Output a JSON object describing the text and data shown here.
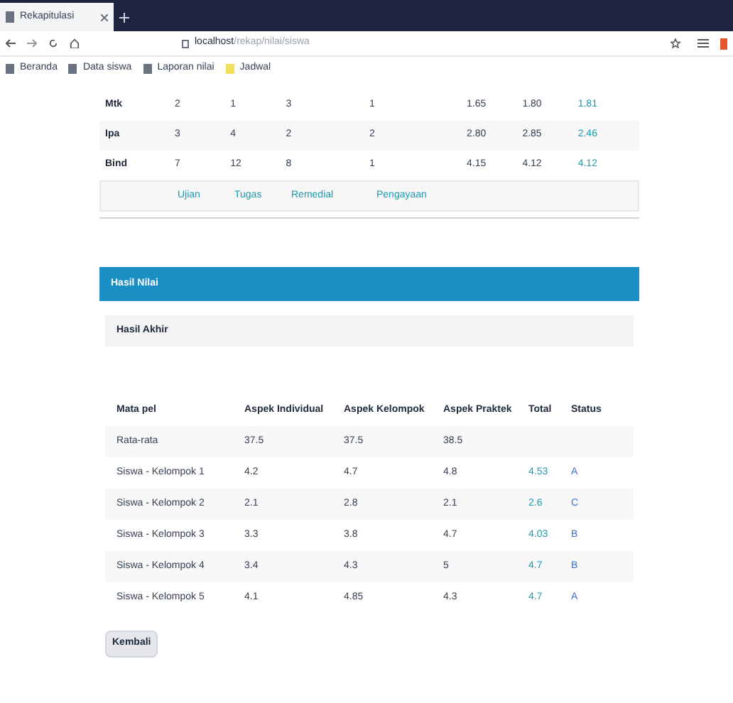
{
  "browser": {
    "tab_title": "Rekapitulasi",
    "url_host": "localhost",
    "url_path": "/rekap/nilai/siswa",
    "bookmarks": [
      "Beranda",
      "Data siswa",
      "Laporan nilai",
      "Jadwal"
    ]
  },
  "summary_table": {
    "rows": [
      {
        "label": "Mtk",
        "cells": [
          "2",
          "1",
          "3",
          "1",
          "1.65",
          "1.80",
          "1.81"
        ]
      },
      {
        "label": "Ipa",
        "cells": [
          "3",
          "4",
          "2",
          "2",
          "2.80",
          "2.85",
          "2.46"
        ]
      },
      {
        "label": "Bind",
        "cells": [
          "7",
          "12",
          "8",
          "1",
          "4.15",
          "4.12",
          "4.12"
        ]
      }
    ],
    "footer_links": [
      "Ujian",
      "Tugas",
      "Remedial",
      "Pengayaan"
    ]
  },
  "section": {
    "title": "Hasil Nilai",
    "subtitle": "Hasil Akhir"
  },
  "results_table": {
    "columns": [
      "Mata pel",
      "Aspek Individual",
      "Aspek Kelompok",
      "Aspek Praktek",
      "Total",
      "Status"
    ],
    "rows": [
      {
        "cells": [
          "Rata-rata",
          "37.5",
          "37.5",
          "38.5",
          "",
          ""
        ]
      },
      {
        "cells": [
          "Siswa - Kelompok 1",
          "4.2",
          "4.7",
          "4.8",
          "4.53",
          "A"
        ]
      },
      {
        "cells": [
          "Siswa - Kelompok 2",
          "2.1",
          "2.8",
          "2.1",
          "2.6",
          "C"
        ]
      },
      {
        "cells": [
          "Siswa - Kelompok 3",
          "3.3",
          "3.8",
          "4.7",
          "4.03",
          "B"
        ]
      },
      {
        "cells": [
          "Siswa - Kelompok 4",
          "3.4",
          "4.3",
          "5",
          "4.7",
          "B"
        ]
      },
      {
        "cells": [
          "Siswa - Kelompok 5",
          "4.1",
          "4.85",
          "4.3",
          "4.7",
          "A"
        ]
      }
    ]
  },
  "back_button": "Kembali"
}
